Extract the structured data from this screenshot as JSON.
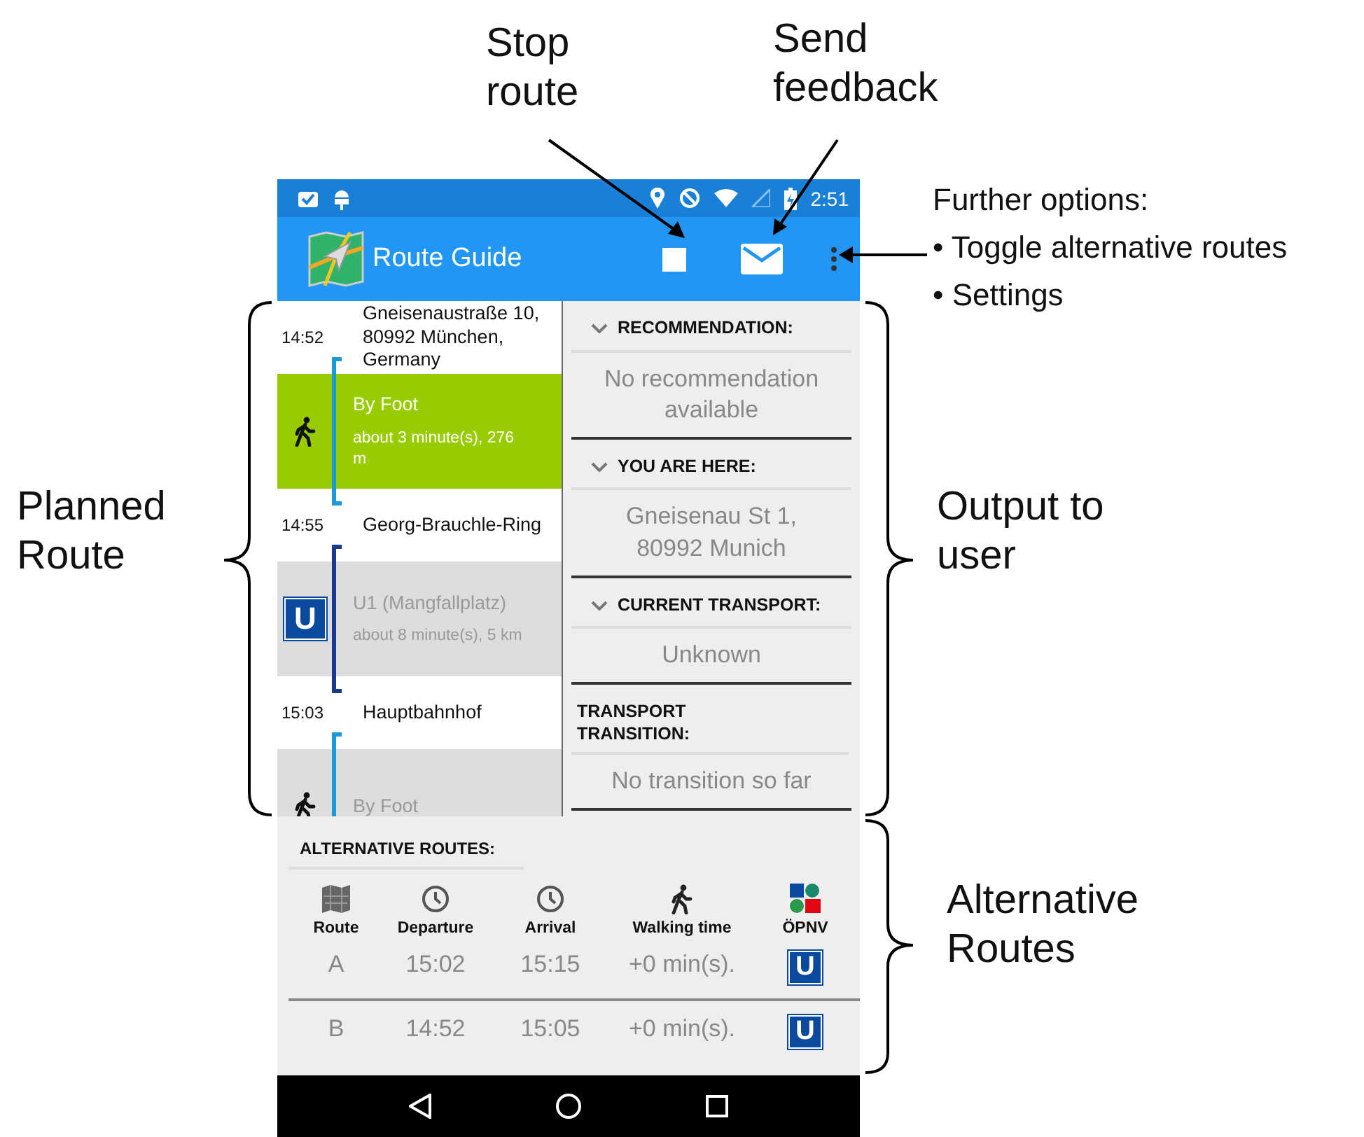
{
  "status_bar": {
    "time": "2:51"
  },
  "app_bar": {
    "title": "Route Guide"
  },
  "route": [
    {
      "kind": "stop",
      "time": "14:52",
      "place": "Gneisenaustraße 10, 80992 München, Germany"
    },
    {
      "kind": "walk",
      "selected": true,
      "color": "#1a9bd7",
      "title": "By Foot",
      "detail": "about 3 minute(s), 276 m"
    },
    {
      "kind": "stop",
      "time": "14:55",
      "place": "Georg-Brauchle-Ring"
    },
    {
      "kind": "subway",
      "selected": false,
      "color": "#1a3a8f",
      "badge": "U",
      "title": "U1 (Mangfallplatz)",
      "detail": "about 8 minute(s), 5 km"
    },
    {
      "kind": "stop",
      "time": "15:03",
      "place": "Hauptbahnhof"
    },
    {
      "kind": "walk",
      "selected": false,
      "color": "#1a9bd7",
      "title": "By Foot"
    }
  ],
  "output": [
    {
      "title": "RECOMMENDATION:",
      "expandable": true,
      "value": "No recommendation available"
    },
    {
      "title": "YOU ARE HERE:",
      "expandable": true,
      "value": "Gneisenau St 1, 80992 Munich"
    },
    {
      "title": "CURRENT TRANSPORT:",
      "expandable": true,
      "value": "Unknown"
    },
    {
      "title": "TRANSPORT TRANSITION:",
      "expandable": false,
      "value": "No transition so far"
    }
  ],
  "alternative_routes": {
    "title": "ALTERNATIVE ROUTES:",
    "columns": [
      {
        "label": "Route",
        "kind": "map"
      },
      {
        "label": "Departure",
        "kind": "clock"
      },
      {
        "label": "Arrival",
        "kind": "clock"
      },
      {
        "label": "Walking time",
        "kind": "walk"
      },
      {
        "label": "ÖPNV",
        "kind": "transit"
      }
    ],
    "rows": [
      {
        "route": "A",
        "departure": "15:02",
        "arrival": "15:15",
        "walking_time": "+0 min(s).",
        "transit": "U"
      },
      {
        "route": "B",
        "departure": "14:52",
        "arrival": "15:05",
        "walking_time": "+0 min(s).",
        "transit": "U"
      }
    ]
  },
  "annotations": {
    "stop_route": "Stop route",
    "send_feedback": "Send feedback",
    "further_options": {
      "title": "Further options:",
      "items": [
        "• Toggle alternative routes",
        "• Settings"
      ]
    },
    "planned_route": "Planned Route",
    "output_to_user": "Output to user",
    "alternative_routes": "Alternative Routes"
  }
}
